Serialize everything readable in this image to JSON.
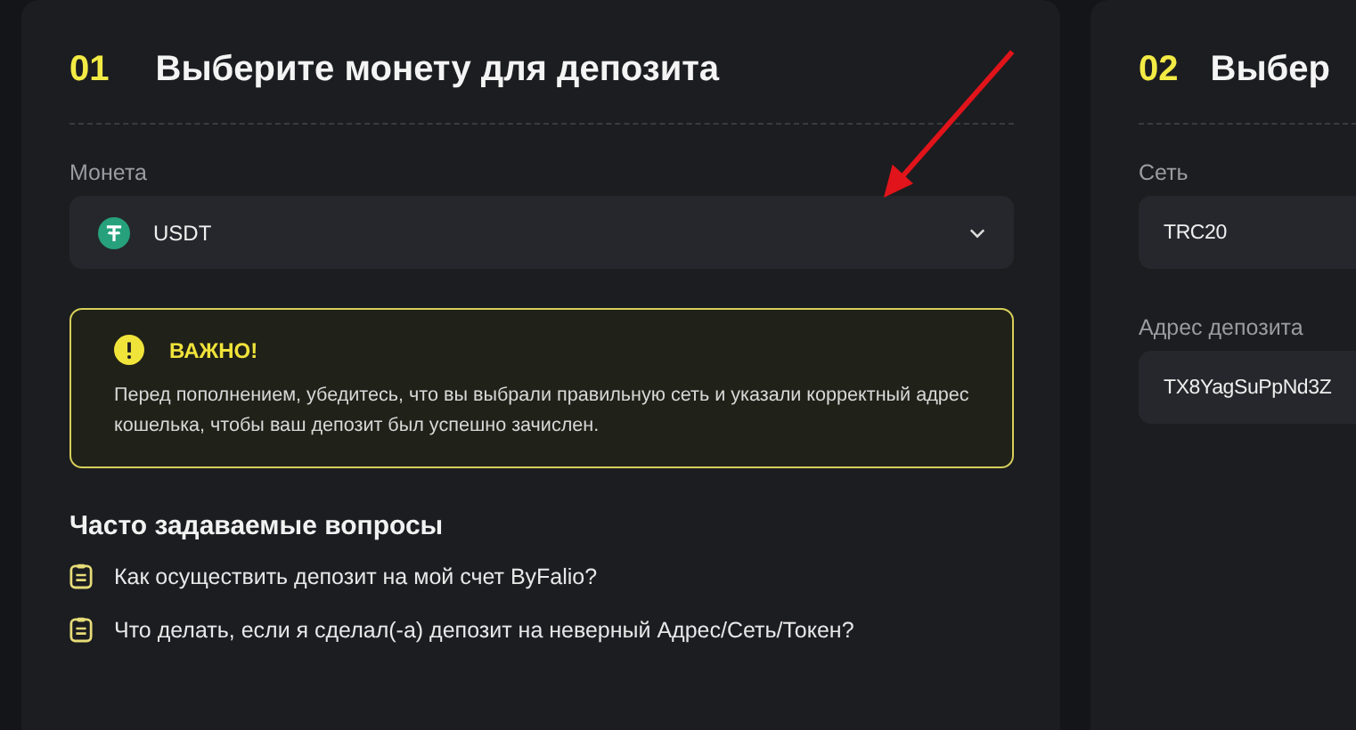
{
  "panels": [
    {
      "number": "01",
      "title": "Выберите монету для депозита",
      "fields": [
        {
          "kind": "coin-select",
          "label": "Монета",
          "value": "USDT"
        }
      ],
      "notice": {
        "title": "ВАЖНО!",
        "text": "Перед пополнением, убедитесь, что вы выбрали правильную сеть и указали корректный адрес кошелька, чтобы ваш депозит был успешно зачислен."
      },
      "faq": {
        "title": "Часто задаваемые вопросы",
        "items": [
          "Как осуществить депозит на мой счет ByFalio?",
          "Что делать, если я сделал(-а) депозит на неверный Адрес/Сеть/Токен?"
        ]
      }
    },
    {
      "number": "02",
      "title": "Выбер",
      "fields": [
        {
          "kind": "text",
          "label": "Сеть",
          "value": "TRC20"
        },
        {
          "kind": "text",
          "label": "Адрес депозита",
          "value": "TX8YagSuPpNd3Z"
        }
      ]
    }
  ]
}
